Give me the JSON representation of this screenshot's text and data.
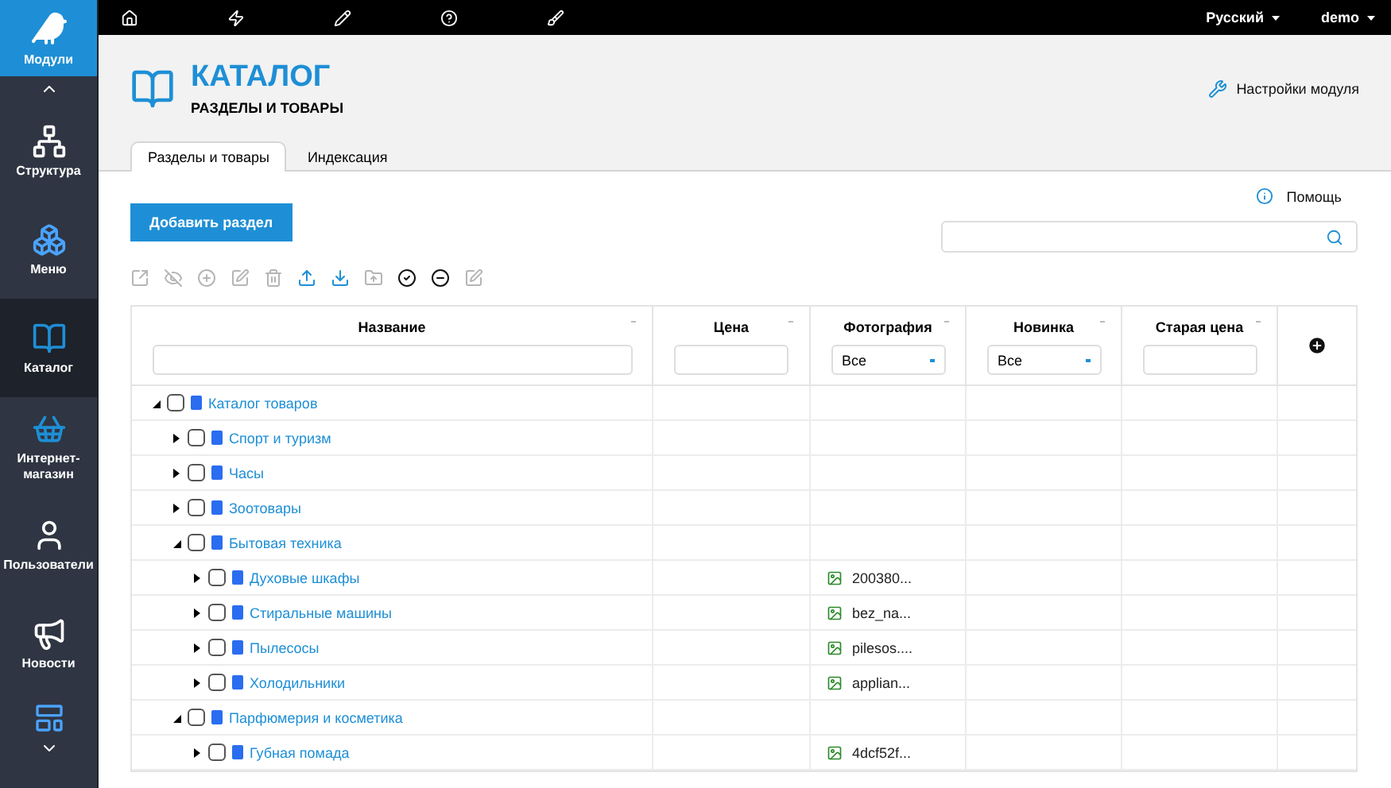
{
  "sidebar": {
    "header": "Модули",
    "items": [
      {
        "label": "Структура",
        "selected": false
      },
      {
        "label": "Меню",
        "selected": false
      },
      {
        "label": "Каталог",
        "selected": true
      },
      {
        "label": "Интернет-магазин",
        "selected": false
      },
      {
        "label": "Пользователи",
        "selected": false
      },
      {
        "label": "Новости",
        "selected": false
      }
    ]
  },
  "top_bar": {
    "language": "Русский",
    "user": "demo"
  },
  "header": {
    "title": "КАТАЛОГ",
    "subtitle": "РАЗДЕЛЫ И ТОВАРЫ",
    "settings_link": "Настройки модуля"
  },
  "tabs": [
    {
      "label": "Разделы и товары",
      "selected": true
    },
    {
      "label": "Индексация",
      "selected": false
    }
  ],
  "help_link": "Помощь",
  "add_button": "Добавить раздел",
  "toolbar": [
    {
      "disabled": true
    },
    {
      "disabled": true
    },
    {
      "disabled": true
    },
    {
      "disabled": true
    },
    {
      "disabled": true
    },
    {
      "disabled": false
    },
    {
      "disabled": false
    },
    {
      "disabled": true
    },
    {
      "disabled": false
    },
    {
      "disabled": false
    },
    {
      "disabled": true
    }
  ],
  "table": {
    "columns": [
      {
        "label": "Название",
        "filter": {
          "kind": "text"
        }
      },
      {
        "label": "Цена",
        "filter": {
          "kind": "text"
        }
      },
      {
        "label": "Фотография",
        "filter": {
          "kind": "select",
          "value": "Все"
        }
      },
      {
        "label": "Новинка",
        "filter": {
          "kind": "select",
          "value": "Все"
        }
      },
      {
        "label": "Старая цена",
        "filter": {
          "kind": "text"
        }
      }
    ],
    "rows": [
      {
        "name": "Каталог товаров",
        "checked": false,
        "expanded": true,
        "children": [
          {
            "name": "Спорт и туризм",
            "checked": false,
            "expanded": false
          },
          {
            "name": "Часы",
            "checked": false,
            "expanded": false
          },
          {
            "name": "Зоотовары",
            "checked": false,
            "expanded": false
          },
          {
            "name": "Бытовая техника",
            "checked": false,
            "expanded": true,
            "children": [
              {
                "name": "Духовые шкафы",
                "checked": false,
                "expanded": false,
                "photo": "200380..."
              },
              {
                "name": "Стиральные машины",
                "checked": false,
                "expanded": false,
                "photo": "bez_na..."
              },
              {
                "name": "Пылесосы",
                "checked": false,
                "expanded": false,
                "photo": "pilesos...."
              },
              {
                "name": "Холодильники",
                "checked": false,
                "expanded": false,
                "photo": "applian..."
              }
            ]
          },
          {
            "name": "Парфюмерия и косметика",
            "checked": false,
            "expanded": true,
            "children": [
              {
                "name": "Губная помада",
                "checked": false,
                "expanded": false,
                "photo": "4dcf52f..."
              }
            ]
          }
        ]
      }
    ]
  }
}
